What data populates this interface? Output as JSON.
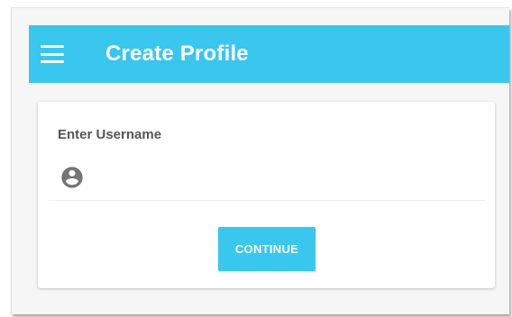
{
  "appbar": {
    "title": "Create Profile",
    "menu_icon": "menu-icon",
    "color": "#39c7ee"
  },
  "form": {
    "label": "Enter Username",
    "field_icon": "account-circle-icon",
    "username_value": "",
    "username_placeholder": ""
  },
  "actions": {
    "continue_label": "CONTINUE",
    "accent": "#39c7ee"
  }
}
